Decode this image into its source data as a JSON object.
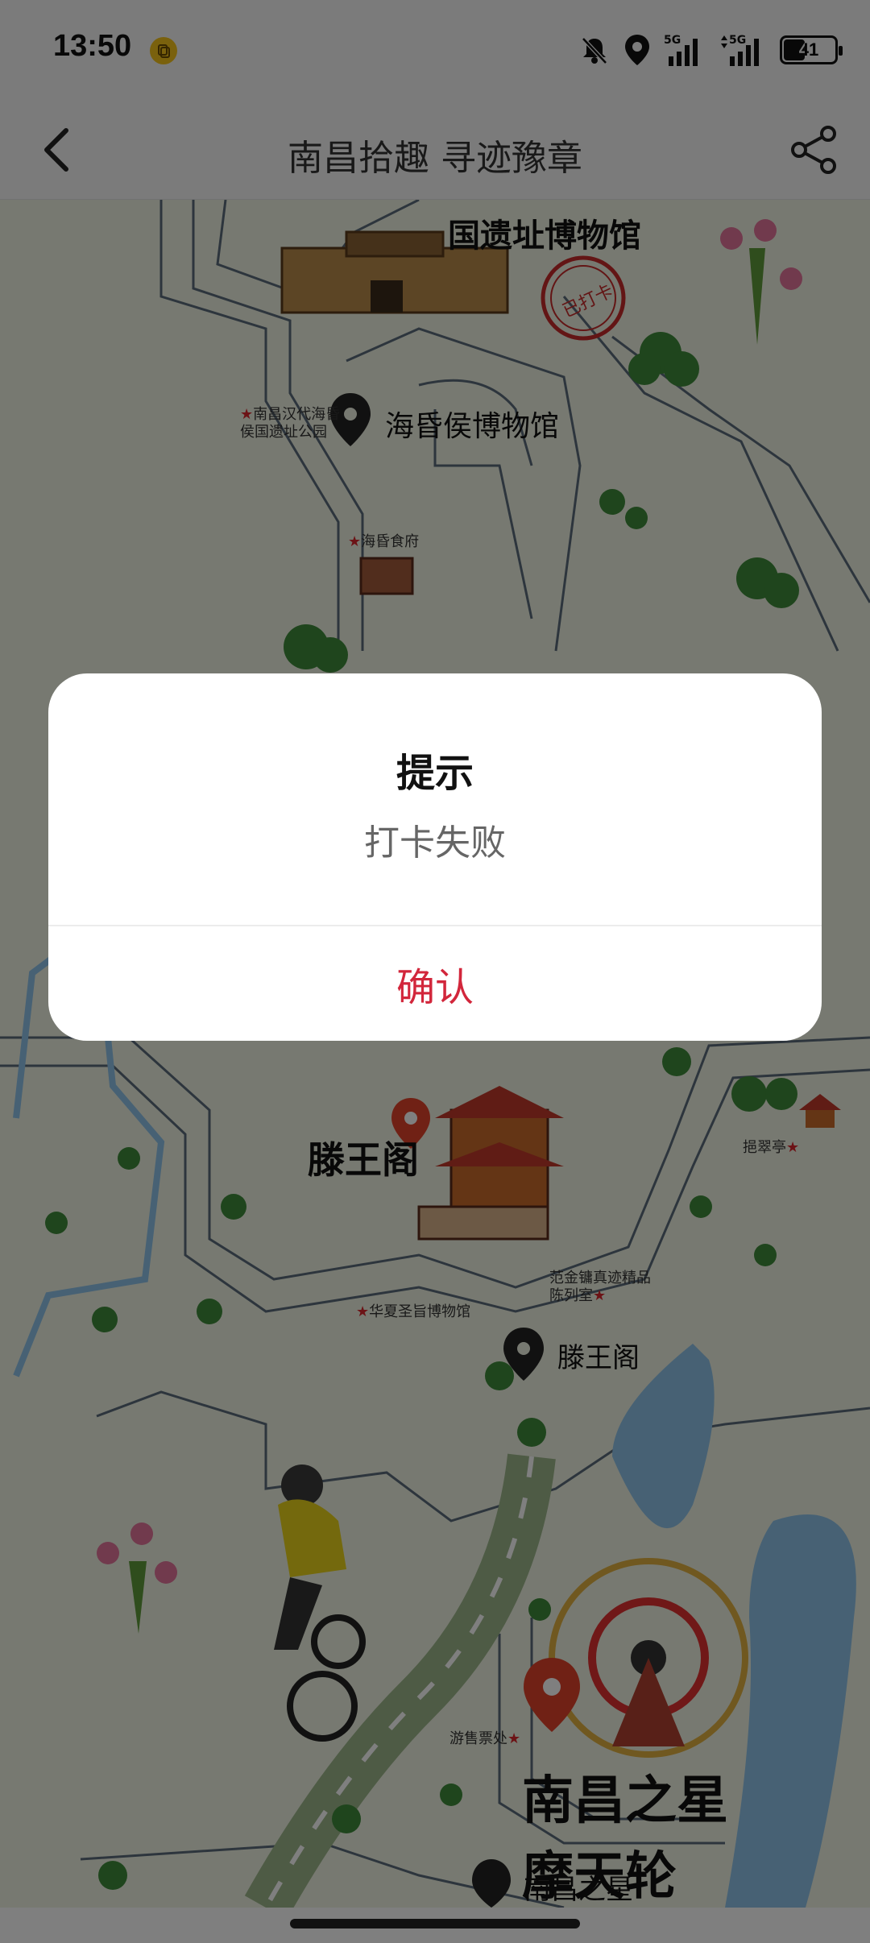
{
  "status_bar": {
    "time": "13:50",
    "battery_level": "41",
    "icons": [
      "app-notification-icon",
      "bell-off-icon",
      "location-icon",
      "signal-5g-icon",
      "signal-5g-icon",
      "battery-icon"
    ]
  },
  "nav": {
    "title": "南昌拾趣 寻迹豫章",
    "back_icon": "back-arrow-icon",
    "share_icon": "share-icon"
  },
  "map": {
    "top_landmark_title": "国遗址博物馆",
    "stamp_text": "已打卡",
    "haihunhou_marker_label": "海昏侯博物馆",
    "haihunhou_park_label": "南昌汉代海昏侯国遗址公园",
    "haihun_food_label": "海昏食府",
    "tengwang_title": "滕王阁",
    "tengwang_marker_label": "滕王阁",
    "jiecui_label": "挹翠亭",
    "fanjinyong_label": "范金镛真迹精品陈列室",
    "huaxia_label": "华夏圣旨博物馆",
    "ticket_label": "游售票处",
    "star_title_line1": "南昌之星",
    "star_title_line2": "摩天轮",
    "star_marker_label": "南昌之星",
    "colors": {
      "road": "#ffffff",
      "river": "#8fc3e8",
      "ground": "#eef3e3",
      "green_path": "#9db68a",
      "marker_red": "#e0432a",
      "marker_dark": "#222222"
    }
  },
  "dialog": {
    "title": "提示",
    "message": "打卡失败",
    "confirm_label": "确认",
    "confirm_color": "#d2263b"
  }
}
